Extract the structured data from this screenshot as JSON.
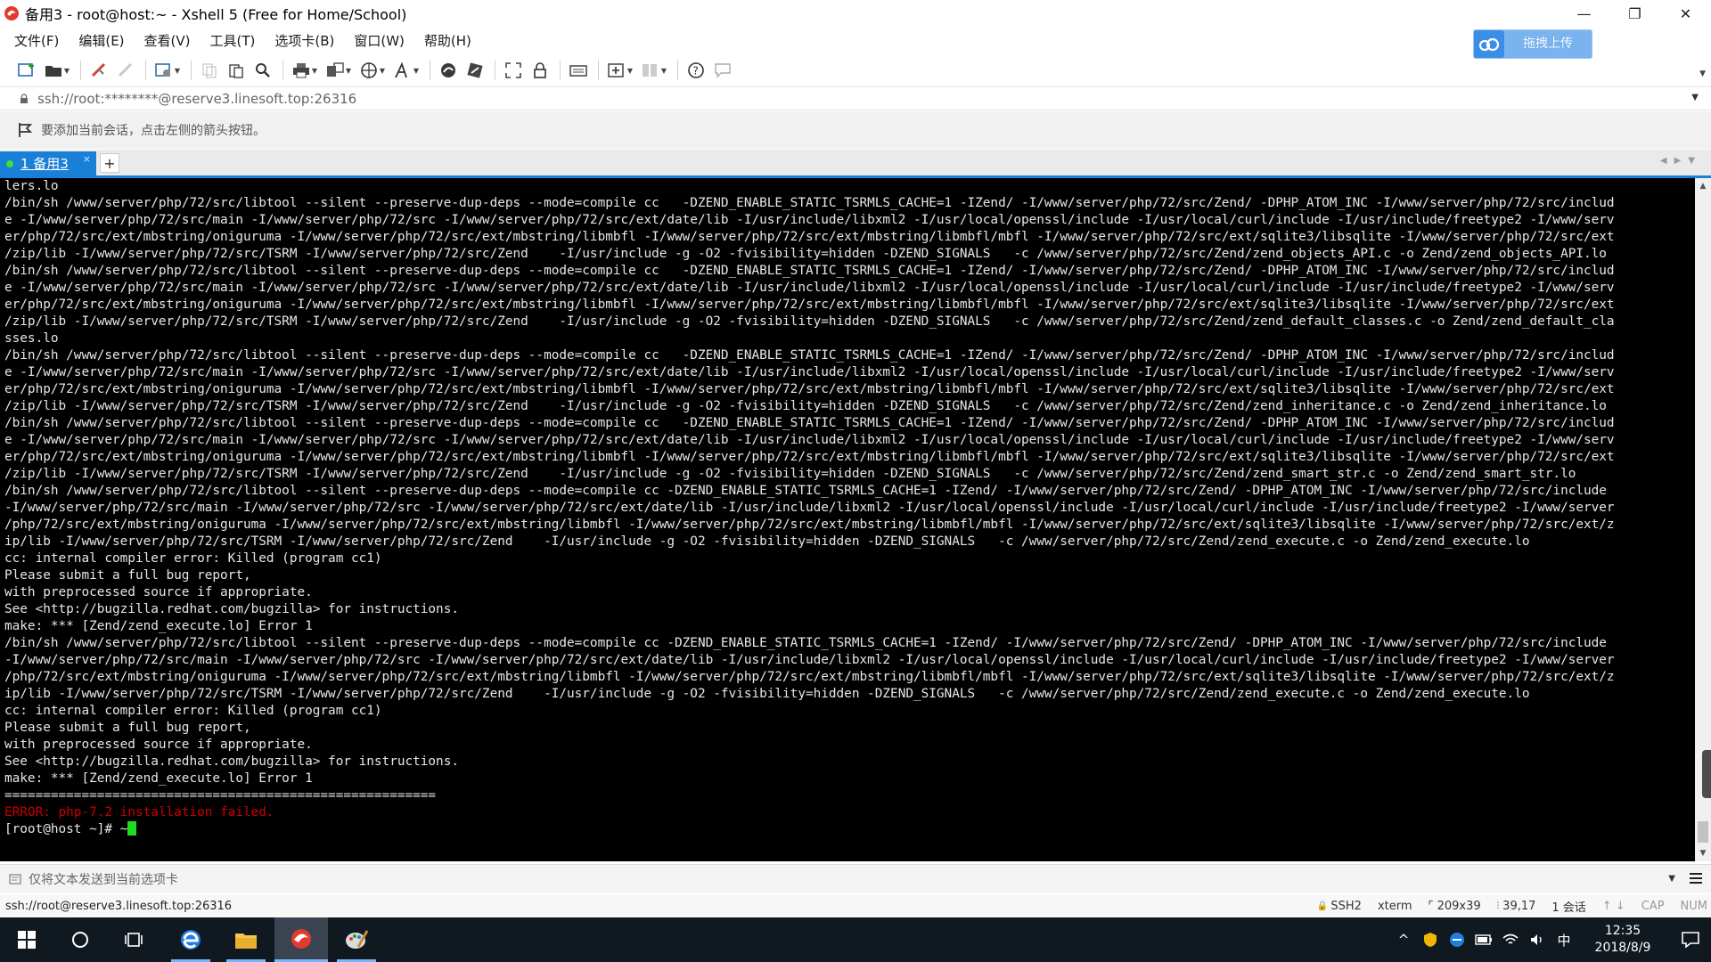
{
  "window": {
    "title": "备用3 - root@host:~ - Xshell 5 (Free for Home/School)",
    "controls": {
      "minimize": "—",
      "restore": "❐",
      "close": "✕"
    }
  },
  "menu": [
    {
      "label": "文件(F)"
    },
    {
      "label": "编辑(E)"
    },
    {
      "label": "查看(V)"
    },
    {
      "label": "工具(T)"
    },
    {
      "label": "选项卡(B)"
    },
    {
      "label": "窗口(W)"
    },
    {
      "label": "帮助(H)"
    }
  ],
  "upload_button": {
    "label": "拖拽上传"
  },
  "address": {
    "value": "ssh://root:********@reserve3.linesoft.top:26316"
  },
  "hint": {
    "text": "要添加当前会话，点击左侧的箭头按钮。"
  },
  "tabs": [
    {
      "label": "1 备用3",
      "close": "×"
    }
  ],
  "tab_add": "+",
  "terminal": {
    "lines": [
      "lers.lo",
      "/bin/sh /www/server/php/72/src/libtool --silent --preserve-dup-deps --mode=compile cc   -DZEND_ENABLE_STATIC_TSRMLS_CACHE=1 -IZend/ -I/www/server/php/72/src/Zend/ -DPHP_ATOM_INC -I/www/server/php/72/src/includ",
      "e -I/www/server/php/72/src/main -I/www/server/php/72/src -I/www/server/php/72/src/ext/date/lib -I/usr/include/libxml2 -I/usr/local/openssl/include -I/usr/local/curl/include -I/usr/include/freetype2 -I/www/serv",
      "er/php/72/src/ext/mbstring/oniguruma -I/www/server/php/72/src/ext/mbstring/libmbfl -I/www/server/php/72/src/ext/mbstring/libmbfl/mbfl -I/www/server/php/72/src/ext/sqlite3/libsqlite -I/www/server/php/72/src/ext",
      "/zip/lib -I/www/server/php/72/src/TSRM -I/www/server/php/72/src/Zend    -I/usr/include -g -O2 -fvisibility=hidden -DZEND_SIGNALS   -c /www/server/php/72/src/Zend/zend_objects_API.c -o Zend/zend_objects_API.lo",
      "/bin/sh /www/server/php/72/src/libtool --silent --preserve-dup-deps --mode=compile cc   -DZEND_ENABLE_STATIC_TSRMLS_CACHE=1 -IZend/ -I/www/server/php/72/src/Zend/ -DPHP_ATOM_INC -I/www/server/php/72/src/includ",
      "e -I/www/server/php/72/src/main -I/www/server/php/72/src -I/www/server/php/72/src/ext/date/lib -I/usr/include/libxml2 -I/usr/local/openssl/include -I/usr/local/curl/include -I/usr/include/freetype2 -I/www/serv",
      "er/php/72/src/ext/mbstring/oniguruma -I/www/server/php/72/src/ext/mbstring/libmbfl -I/www/server/php/72/src/ext/mbstring/libmbfl/mbfl -I/www/server/php/72/src/ext/sqlite3/libsqlite -I/www/server/php/72/src/ext",
      "/zip/lib -I/www/server/php/72/src/TSRM -I/www/server/php/72/src/Zend    -I/usr/include -g -O2 -fvisibility=hidden -DZEND_SIGNALS   -c /www/server/php/72/src/Zend/zend_default_classes.c -o Zend/zend_default_cla",
      "sses.lo",
      "/bin/sh /www/server/php/72/src/libtool --silent --preserve-dup-deps --mode=compile cc   -DZEND_ENABLE_STATIC_TSRMLS_CACHE=1 -IZend/ -I/www/server/php/72/src/Zend/ -DPHP_ATOM_INC -I/www/server/php/72/src/includ",
      "e -I/www/server/php/72/src/main -I/www/server/php/72/src -I/www/server/php/72/src/ext/date/lib -I/usr/include/libxml2 -I/usr/local/openssl/include -I/usr/local/curl/include -I/usr/include/freetype2 -I/www/serv",
      "er/php/72/src/ext/mbstring/oniguruma -I/www/server/php/72/src/ext/mbstring/libmbfl -I/www/server/php/72/src/ext/mbstring/libmbfl/mbfl -I/www/server/php/72/src/ext/sqlite3/libsqlite -I/www/server/php/72/src/ext",
      "/zip/lib -I/www/server/php/72/src/TSRM -I/www/server/php/72/src/Zend    -I/usr/include -g -O2 -fvisibility=hidden -DZEND_SIGNALS   -c /www/server/php/72/src/Zend/zend_inheritance.c -o Zend/zend_inheritance.lo",
      "/bin/sh /www/server/php/72/src/libtool --silent --preserve-dup-deps --mode=compile cc   -DZEND_ENABLE_STATIC_TSRMLS_CACHE=1 -IZend/ -I/www/server/php/72/src/Zend/ -DPHP_ATOM_INC -I/www/server/php/72/src/includ",
      "e -I/www/server/php/72/src/main -I/www/server/php/72/src -I/www/server/php/72/src/ext/date/lib -I/usr/include/libxml2 -I/usr/local/openssl/include -I/usr/local/curl/include -I/usr/include/freetype2 -I/www/serv",
      "er/php/72/src/ext/mbstring/oniguruma -I/www/server/php/72/src/ext/mbstring/libmbfl -I/www/server/php/72/src/ext/mbstring/libmbfl/mbfl -I/www/server/php/72/src/ext/sqlite3/libsqlite -I/www/server/php/72/src/ext",
      "/zip/lib -I/www/server/php/72/src/TSRM -I/www/server/php/72/src/Zend    -I/usr/include -g -O2 -fvisibility=hidden -DZEND_SIGNALS   -c /www/server/php/72/src/Zend/zend_smart_str.c -o Zend/zend_smart_str.lo",
      "/bin/sh /www/server/php/72/src/libtool --silent --preserve-dup-deps --mode=compile cc -DZEND_ENABLE_STATIC_TSRMLS_CACHE=1 -IZend/ -I/www/server/php/72/src/Zend/ -DPHP_ATOM_INC -I/www/server/php/72/src/include",
      "-I/www/server/php/72/src/main -I/www/server/php/72/src -I/www/server/php/72/src/ext/date/lib -I/usr/include/libxml2 -I/usr/local/openssl/include -I/usr/local/curl/include -I/usr/include/freetype2 -I/www/server",
      "/php/72/src/ext/mbstring/oniguruma -I/www/server/php/72/src/ext/mbstring/libmbfl -I/www/server/php/72/src/ext/mbstring/libmbfl/mbfl -I/www/server/php/72/src/ext/sqlite3/libsqlite -I/www/server/php/72/src/ext/z",
      "ip/lib -I/www/server/php/72/src/TSRM -I/www/server/php/72/src/Zend    -I/usr/include -g -O2 -fvisibility=hidden -DZEND_SIGNALS   -c /www/server/php/72/src/Zend/zend_execute.c -o Zend/zend_execute.lo",
      "cc: internal compiler error: Killed (program cc1)",
      "Please submit a full bug report,",
      "with preprocessed source if appropriate.",
      "See <http://bugzilla.redhat.com/bugzilla> for instructions.",
      "make: *** [Zend/zend_execute.lo] Error 1",
      "/bin/sh /www/server/php/72/src/libtool --silent --preserve-dup-deps --mode=compile cc -DZEND_ENABLE_STATIC_TSRMLS_CACHE=1 -IZend/ -I/www/server/php/72/src/Zend/ -DPHP_ATOM_INC -I/www/server/php/72/src/include",
      "-I/www/server/php/72/src/main -I/www/server/php/72/src -I/www/server/php/72/src/ext/date/lib -I/usr/include/libxml2 -I/usr/local/openssl/include -I/usr/local/curl/include -I/usr/include/freetype2 -I/www/server",
      "/php/72/src/ext/mbstring/oniguruma -I/www/server/php/72/src/ext/mbstring/libmbfl -I/www/server/php/72/src/ext/mbstring/libmbfl/mbfl -I/www/server/php/72/src/ext/sqlite3/libsqlite -I/www/server/php/72/src/ext/z",
      "ip/lib -I/www/server/php/72/src/TSRM -I/www/server/php/72/src/Zend    -I/usr/include -g -O2 -fvisibility=hidden -DZEND_SIGNALS   -c /www/server/php/72/src/Zend/zend_execute.c -o Zend/zend_execute.lo",
      "cc: internal compiler error: Killed (program cc1)",
      "Please submit a full bug report,",
      "with preprocessed source if appropriate.",
      "See <http://bugzilla.redhat.com/bugzilla> for instructions.",
      "make: *** [Zend/zend_execute.lo] Error 1",
      "========================================================"
    ],
    "error_line": "ERROR: php-7.2 installation failed.",
    "prompt": "[root@host ~]# ~"
  },
  "compose": {
    "placeholder": "仅将文本发送到当前选项卡"
  },
  "status": {
    "connection": "ssh://root@reserve3.linesoft.top:26316",
    "protocol": "SSH2",
    "terminal_type": "xterm",
    "size": "209x39",
    "cursor_pos": "39,17",
    "sessions": "1 会话",
    "cap": "CAP",
    "num": "NUM"
  },
  "taskbar": {
    "ime": "中",
    "time": "12:35",
    "date": "2018/8/9"
  },
  "colors": {
    "accent": "#1a7fd6",
    "terminal_bg": "#000000",
    "terminal_fg": "#e6e6e6",
    "error": "#c80000",
    "cursor": "#1fdc1f"
  }
}
